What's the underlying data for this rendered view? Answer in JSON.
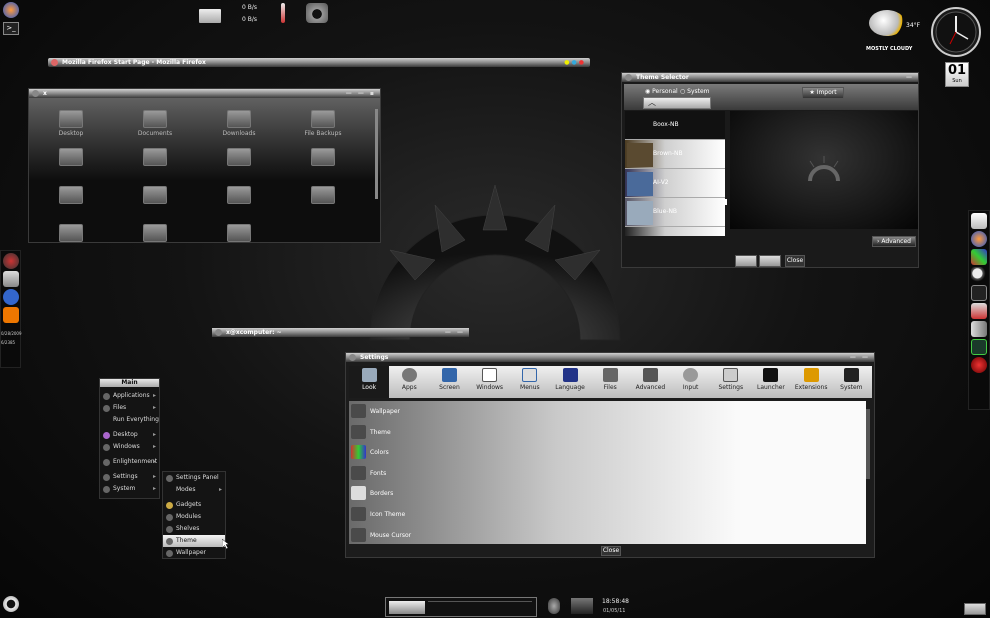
{
  "topbar": {
    "net_down": "0 B/s",
    "net_up": "0 B/s"
  },
  "weather": {
    "temp": "34°F",
    "condition": "MOSTLY CLOUDY"
  },
  "calendar": {
    "day": "01",
    "weekday": "Sun"
  },
  "firefox_window": {
    "title": "Mozilla Firefox Start Page - Mozilla Firefox"
  },
  "file_window": {
    "title": "x",
    "folders": [
      "Desktop",
      "Documents",
      "Downloads",
      "File Backups",
      "",
      "",
      "",
      "",
      "",
      "",
      "",
      "",
      "",
      "",
      ""
    ]
  },
  "terminal_window": {
    "title": "x@xcomputer: ~"
  },
  "theme_selector": {
    "title": "Theme Selector",
    "radio_personal": "Personal",
    "radio_system": "System",
    "import_label": "Import",
    "themes": [
      "Boox-NB",
      "Brown-NB",
      "AI-V2",
      "Blue-NB",
      ""
    ],
    "advanced_label": "Advanced",
    "close_label": "Close"
  },
  "settings": {
    "title": "Settings",
    "categories": [
      "Look",
      "Apps",
      "Screen",
      "Windows",
      "Menus",
      "Language",
      "Files",
      "Advanced",
      "Input",
      "Settings",
      "Launcher",
      "Extensions",
      "System"
    ],
    "items": [
      "Wallpaper",
      "Theme",
      "Colors",
      "Fonts",
      "Borders",
      "Icon Theme",
      "Mouse Cursor"
    ],
    "close_label": "Close"
  },
  "main_menu": {
    "title": "Main",
    "items": [
      {
        "label": "Applications",
        "sub": true
      },
      {
        "label": "Files",
        "sub": true
      },
      {
        "label": "Run Everything",
        "sub": false
      },
      {
        "label": "Desktop",
        "sub": true
      },
      {
        "label": "Windows",
        "sub": true
      },
      {
        "label": "Enlightenment",
        "sub": true
      },
      {
        "label": "Settings",
        "sub": true
      },
      {
        "label": "System",
        "sub": true
      }
    ]
  },
  "settings_submenu": {
    "items": [
      "Settings Panel",
      "Modes",
      "Gadgets",
      "Modules",
      "Shelves",
      "Theme",
      "Wallpaper"
    ]
  },
  "left_gadget": {
    "line1": "0/28/2009",
    "line2": "6/2385"
  },
  "bottom_bar": {
    "time": "18:58:48",
    "date": "01/05/11"
  },
  "colors": {
    "title_bar": "#b0b0b0",
    "highlight": "#e8e8e8",
    "background": "#0d0d0d"
  }
}
